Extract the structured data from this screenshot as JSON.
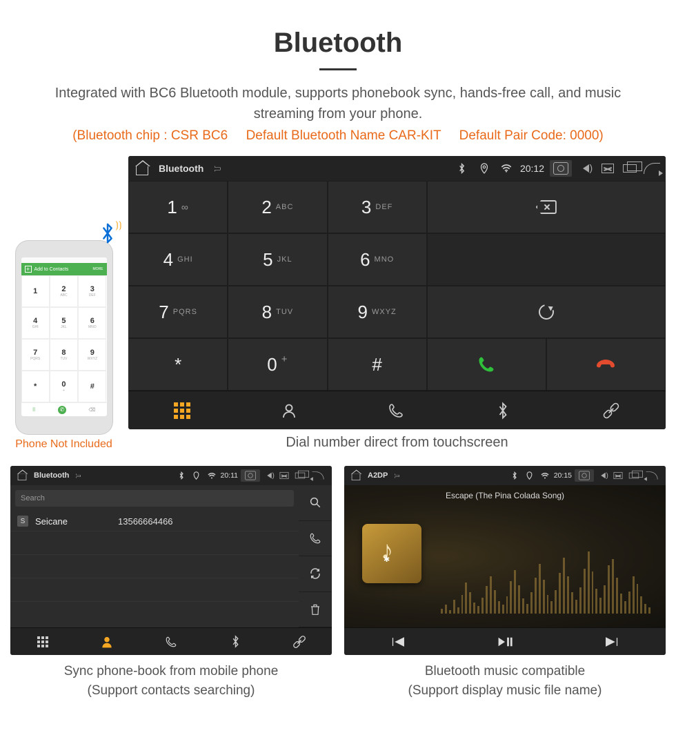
{
  "title": "Bluetooth",
  "subtitle": "Integrated with BC6 Bluetooth module, supports phonebook sync, hands-free call, and music streaming from your phone.",
  "specs": "(Bluetooth chip : CSR BC6     Default Bluetooth Name CAR-KIT     Default Pair Code: 0000)",
  "phone_mock": {
    "header": "Add to Contacts",
    "more": "MORE",
    "keys": [
      {
        "n": "1",
        "l": ""
      },
      {
        "n": "2",
        "l": "ABC"
      },
      {
        "n": "3",
        "l": "DEF"
      },
      {
        "n": "4",
        "l": "GHI"
      },
      {
        "n": "5",
        "l": "JKL"
      },
      {
        "n": "6",
        "l": "MNO"
      },
      {
        "n": "7",
        "l": "PQRS"
      },
      {
        "n": "8",
        "l": "TUV"
      },
      {
        "n": "9",
        "l": "WXYZ"
      },
      {
        "n": "*",
        "l": ""
      },
      {
        "n": "0",
        "l": "+"
      },
      {
        "n": "#",
        "l": ""
      }
    ],
    "note": "Phone Not Included"
  },
  "dialer": {
    "bar": {
      "title": "Bluetooth",
      "time": "20:12"
    },
    "keys": [
      {
        "n": "1",
        "l": "∞"
      },
      {
        "n": "2",
        "l": "ABC"
      },
      {
        "n": "3",
        "l": "DEF"
      },
      {
        "n": "4",
        "l": "GHI"
      },
      {
        "n": "5",
        "l": "JKL"
      },
      {
        "n": "6",
        "l": "MNO"
      },
      {
        "n": "7",
        "l": "PQRS"
      },
      {
        "n": "8",
        "l": "TUV"
      },
      {
        "n": "9",
        "l": "WXYZ"
      },
      {
        "n": "*",
        "l": ""
      },
      {
        "n": "0",
        "l": "+",
        "sup": "+"
      },
      {
        "n": "#",
        "l": ""
      }
    ],
    "caption": "Dial number direct from touchscreen"
  },
  "contacts": {
    "bar": {
      "title": "Bluetooth",
      "time": "20:11"
    },
    "search_placeholder": "Search",
    "rows": [
      {
        "badge": "S",
        "name": "Seicane",
        "number": "13566664466"
      }
    ],
    "caption_l1": "Sync phone-book from mobile phone",
    "caption_l2": "(Support contacts searching)"
  },
  "music": {
    "bar": {
      "title": "A2DP",
      "time": "20:15"
    },
    "song": "Escape (The Pina Colada Song)",
    "caption_l1": "Bluetooth music compatible",
    "caption_l2": "(Support display music file name)"
  }
}
